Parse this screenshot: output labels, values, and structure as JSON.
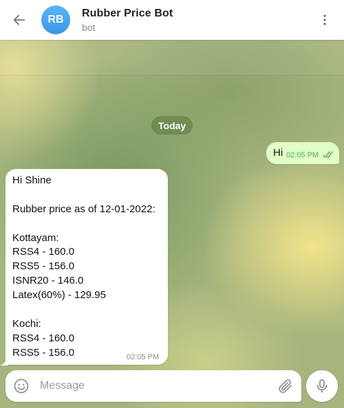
{
  "header": {
    "avatar_initials": "RB",
    "title": "Rubber Price Bot",
    "subtitle": "bot"
  },
  "chat": {
    "date_label": "Today",
    "outgoing": {
      "text": "Hi",
      "time": "02:05 PM",
      "status": "read"
    },
    "incoming": {
      "lines": [
        "Hi Shine",
        "",
        "Rubber price as of 12-01-2022:",
        "",
        "Kottayam:",
        "RSS4 - 160.0",
        "RSS5 - 156.0",
        "ISNR20 - 146.0",
        "Latex(60%) - 129.95",
        "",
        "Kochi:",
        "RSS4 - 160.0",
        "RSS5 - 156.0"
      ],
      "time": "02:05 PM"
    }
  },
  "composer": {
    "placeholder": "Message",
    "value": ""
  },
  "icons": {
    "back": "arrow-left-icon",
    "menu": "more-vertical-icon",
    "emoji": "smile-icon",
    "attach": "paperclip-icon",
    "mic": "microphone-icon",
    "read_ticks": "double-check-icon"
  },
  "colors": {
    "avatar": "#4aa5ee",
    "outgoing_bubble": "#e1ffc7",
    "outgoing_time": "#4fae4e",
    "incoming_bubble": "#ffffff"
  }
}
